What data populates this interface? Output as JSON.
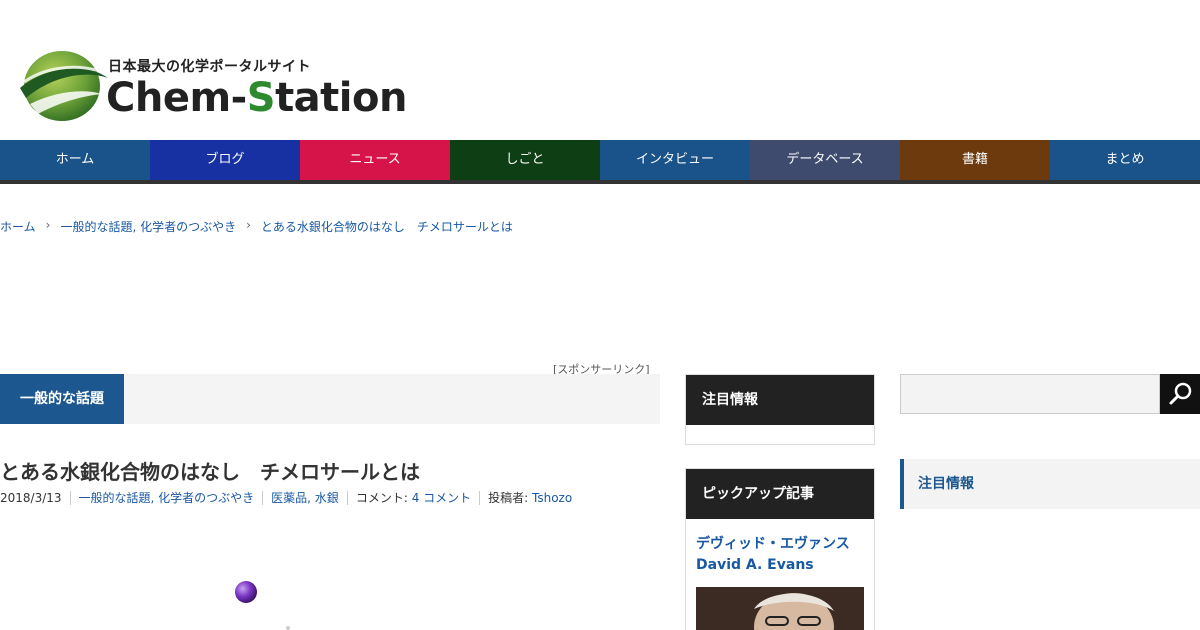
{
  "header": {
    "tagline": "日本最大の化学ポータルサイト",
    "wordmark_part1": "Chem-",
    "wordmark_s": "S",
    "wordmark_part2": "tation",
    "brand_green": "#2f8a2f"
  },
  "nav": {
    "items": [
      {
        "label": "ホーム",
        "color": "#1a528a"
      },
      {
        "label": "ブログ",
        "color": "#1731a3"
      },
      {
        "label": "ニュース",
        "color": "#d7144a"
      },
      {
        "label": "しごと",
        "color": "#0e3e14"
      },
      {
        "label": "インタビュー",
        "color": "#1a528a"
      },
      {
        "label": "データベース",
        "color": "#3e4b6e"
      },
      {
        "label": "書籍",
        "color": "#6c3a0c"
      },
      {
        "label": "まとめ",
        "color": "#1a528a"
      }
    ]
  },
  "breadcrumb": {
    "items": [
      "ホーム",
      "一般的な話題, 化学者のつぶやき",
      "とある水銀化合物のはなし　チメロサールとは"
    ],
    "separator": "›"
  },
  "sponsor_label": "[スポンサーリンク]",
  "category_tag": "一般的な話題",
  "article": {
    "title": "とある水銀化合物のはなし　チメロサールとは",
    "date": "2018/3/13",
    "categories": "一般的な話題, 化学者のつぶやき",
    "tags": "医薬品, 水銀",
    "comment_label": "コメント:",
    "comment_link": "4 コメント",
    "author_label": "投稿者:",
    "author": "Tshozo"
  },
  "sidebar": {
    "notice_heading": "注目情報",
    "pickup_heading": "ピックアップ記事",
    "pickup_title_ja": "デヴィッド・エヴァンス",
    "pickup_title_en": "David A. Evans"
  },
  "right_column": {
    "notice_heading": "注目情報",
    "search_icon": "search-icon"
  }
}
